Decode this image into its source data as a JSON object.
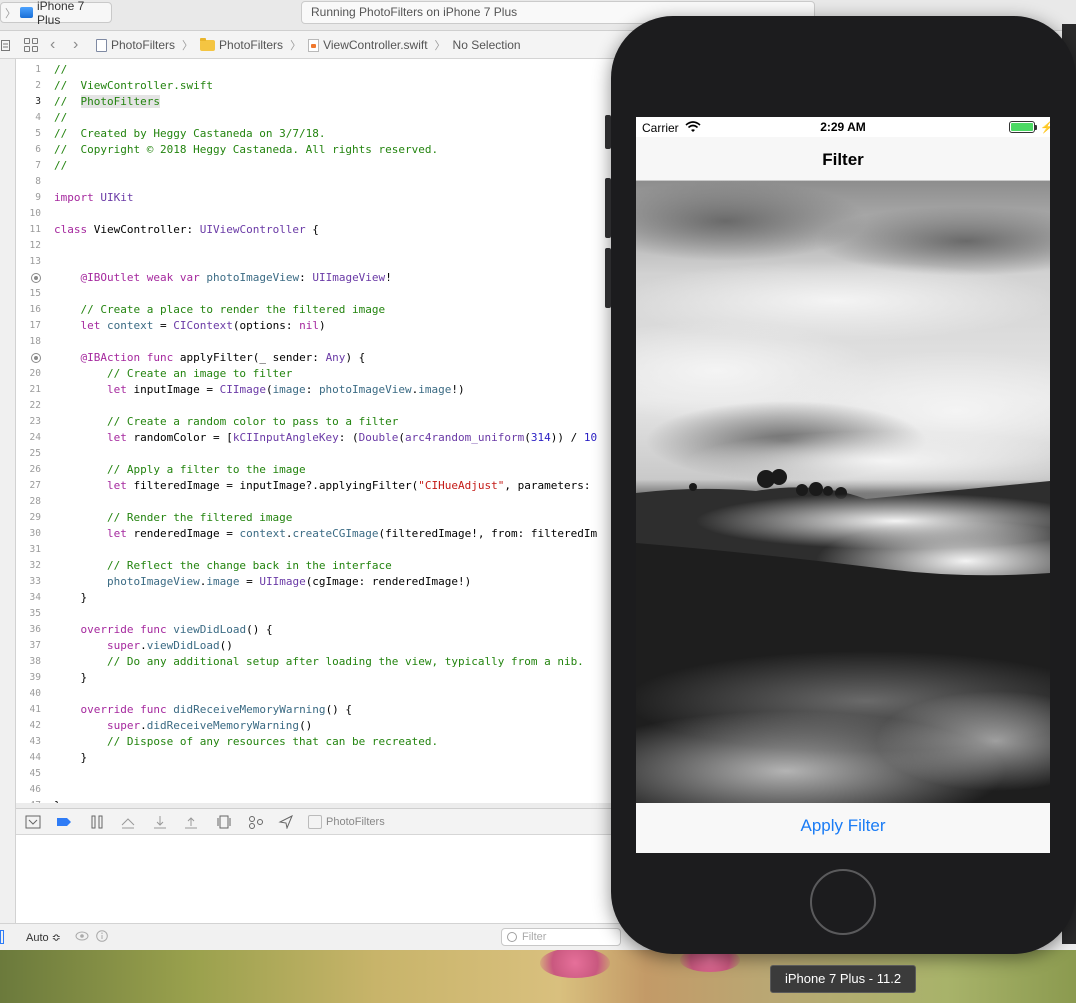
{
  "toolbar": {
    "scheme_device": "iPhone 7 Plus",
    "activity_status": "Running PhotoFilters on iPhone 7 Plus"
  },
  "jumpbar": {
    "crumbs": [
      "PhotoFilters",
      "PhotoFilters",
      "ViewController.swift",
      "No Selection"
    ]
  },
  "editor": {
    "current_line": 3,
    "lines": [
      {
        "n": "1",
        "text": "//"
      },
      {
        "n": "2",
        "text": "//  ViewController.swift"
      },
      {
        "n": "3",
        "text": "//  PhotoFilters"
      },
      {
        "n": "4",
        "text": "//"
      },
      {
        "n": "5",
        "text": "//  Created by Heggy Castaneda on 3/7/18."
      },
      {
        "n": "6",
        "text": "//  Copyright © 2018 Heggy Castaneda. All rights reserved."
      },
      {
        "n": "7",
        "text": "//"
      },
      {
        "n": "8",
        "text": ""
      },
      {
        "n": "9",
        "text": "import UIKit"
      },
      {
        "n": "10",
        "text": ""
      },
      {
        "n": "11",
        "text": "class ViewController: UIViewController {"
      },
      {
        "n": "12",
        "text": ""
      },
      {
        "n": "13",
        "text": ""
      },
      {
        "n": "14",
        "text": "    @IBOutlet weak var photoImageView: UIImageView!"
      },
      {
        "n": "15",
        "text": ""
      },
      {
        "n": "16",
        "text": "    // Create a place to render the filtered image"
      },
      {
        "n": "17",
        "text": "    let context = CIContext(options: nil)"
      },
      {
        "n": "18",
        "text": ""
      },
      {
        "n": "19",
        "text": "    @IBAction func applyFilter(_ sender: Any) {"
      },
      {
        "n": "20",
        "text": "        // Create an image to filter"
      },
      {
        "n": "21",
        "text": "        let inputImage = CIImage(image: photoImageView.image!)"
      },
      {
        "n": "22",
        "text": ""
      },
      {
        "n": "23",
        "text": "        // Create a random color to pass to a filter"
      },
      {
        "n": "24",
        "text": "        let randomColor = [kCIInputAngleKey: (Double(arc4random_uniform(314)) / 10"
      },
      {
        "n": "25",
        "text": ""
      },
      {
        "n": "26",
        "text": "        // Apply a filter to the image"
      },
      {
        "n": "27",
        "text": "        let filteredImage = inputImage?.applyingFilter(\"CIHueAdjust\", parameters:"
      },
      {
        "n": "28",
        "text": ""
      },
      {
        "n": "29",
        "text": "        // Render the filtered image"
      },
      {
        "n": "30",
        "text": "        let renderedImage = context.createCGImage(filteredImage!, from: filteredIm"
      },
      {
        "n": "31",
        "text": ""
      },
      {
        "n": "32",
        "text": "        // Reflect the change back in the interface"
      },
      {
        "n": "33",
        "text": "        photoImageView.image = UIImage(cgImage: renderedImage!)"
      },
      {
        "n": "34",
        "text": "    }"
      },
      {
        "n": "35",
        "text": ""
      },
      {
        "n": "36",
        "text": "    override func viewDidLoad() {"
      },
      {
        "n": "37",
        "text": "        super.viewDidLoad()"
      },
      {
        "n": "38",
        "text": "        // Do any additional setup after loading the view, typically from a nib."
      },
      {
        "n": "39",
        "text": "    }"
      },
      {
        "n": "40",
        "text": ""
      },
      {
        "n": "41",
        "text": "    override func didReceiveMemoryWarning() {"
      },
      {
        "n": "42",
        "text": "        super.didReceiveMemoryWarning()"
      },
      {
        "n": "43",
        "text": "        // Dispose of any resources that can be recreated."
      },
      {
        "n": "44",
        "text": "    }"
      },
      {
        "n": "45",
        "text": ""
      },
      {
        "n": "46",
        "text": ""
      },
      {
        "n": "47",
        "text": "}"
      }
    ]
  },
  "debugbar": {
    "target_label": "PhotoFilters"
  },
  "bottombar": {
    "auto_label": "Auto ≎",
    "filter_placeholder": "Filter"
  },
  "simulator": {
    "status": {
      "carrier": "Carrier",
      "time": "2:29 AM"
    },
    "nav_title": "Filter",
    "apply_button": "Apply Filter"
  },
  "tooltip": "iPhone 7 Plus - 11.2",
  "icons": {
    "breakpoint": "breakpoint-icon",
    "wifi": "wifi-icon",
    "battery": "battery-icon",
    "charging": "bolt-icon"
  },
  "colors": {
    "comment": "#23840f",
    "keyword": "#a5289e",
    "type": "#6a3aa6",
    "string": "#c41a16",
    "property": "#3b6b84",
    "number": "#2a1fc4",
    "ios_blue": "#1a7cf5",
    "battery_green": "#4cd964"
  }
}
